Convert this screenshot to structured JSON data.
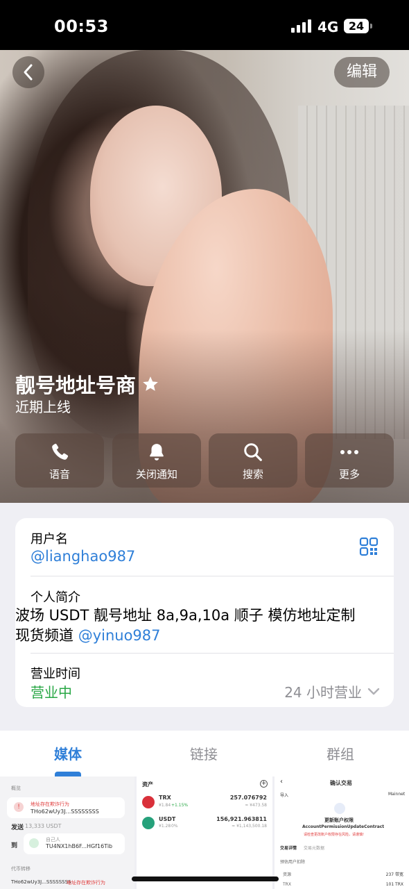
{
  "status_bar": {
    "time": "00:53",
    "network": "4G",
    "battery": "24"
  },
  "header": {
    "edit_label": "编辑"
  },
  "profile": {
    "name": "靓号地址号商",
    "last_seen": "近期上线"
  },
  "actions": [
    {
      "label": "语音",
      "icon": "phone-icon"
    },
    {
      "label": "关闭通知",
      "icon": "bell-icon"
    },
    {
      "label": "搜索",
      "icon": "search-icon"
    },
    {
      "label": "更多",
      "icon": "more-icon"
    }
  ],
  "info": {
    "username_label": "用户名",
    "username": "@lianghao987",
    "bio_label": "个人简介",
    "bio_text": "波场 USDT 靓号地址 8a,9a,10a 顺子 模仿地址定制 现货频道 ",
    "bio_link": "@yinuo987",
    "hours_label": "营业时间",
    "hours_status": "营业中",
    "hours_value": "24 小时营业"
  },
  "tabs": [
    {
      "label": "媒体",
      "active": true
    },
    {
      "label": "链接",
      "active": false
    },
    {
      "label": "群组",
      "active": false
    }
  ],
  "media": {
    "thumb1": {
      "section": "概览",
      "warning": "地址存在欺诈行为",
      "address": "THo62wUy3J...SSSSSSSS",
      "send_label": "发送",
      "send_amount": "13,333 USDT",
      "to_label": "到",
      "to_name": "自己人",
      "to_address": "TU4NX1hB6F...HGf16Tib",
      "section2": "代币转移",
      "address2": "THo62wUy3J...SSSSSSSS",
      "warning2": "地址存在欺诈行为"
    },
    "thumb2": {
      "assets_label": "资产",
      "row1_symbol": "TRX",
      "row1_sub": "¥1.84",
      "row1_change": "+1.15%",
      "row1_amount": "257.076792",
      "row1_value": "≈ ¥473.58",
      "row2_symbol": "USDT",
      "row2_sub": "¥1.28",
      "row2_change": "0%",
      "row2_amount": "156,921.963811",
      "row2_value": "≈ ¥1,143,500.18"
    },
    "thumb3": {
      "title": "确认交易",
      "left_label": "导入",
      "network": "Mainnet",
      "heading": "更新账户权限",
      "contract": "AccountPermissionUpdateContract",
      "warning": "请检查更改账户权限存在风险，请谨慎!",
      "tab1": "交易详情",
      "tab2": "交易元数据",
      "fee_label": "预估用户扣除",
      "bw_label": "资源",
      "bw_value": "237 带宽",
      "trx_label": "TRX",
      "trx_value": "101 TRX"
    }
  },
  "colors": {
    "accent": "#2f7fd8",
    "open_status": "#28a745",
    "danger": "#e03b3b"
  }
}
